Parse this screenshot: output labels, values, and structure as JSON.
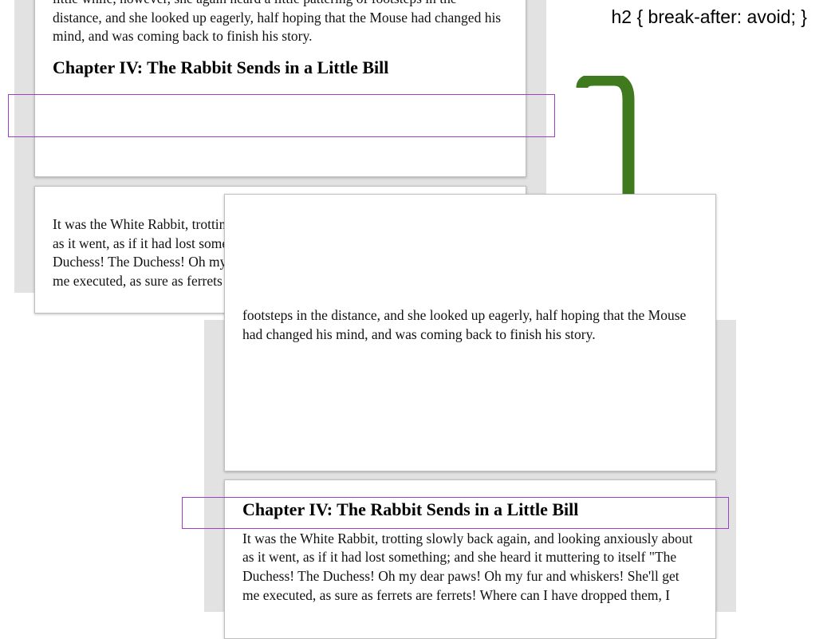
{
  "code_label": "h2 { break-after: avoid; }",
  "para_before_top": "little while, however, she again heard a little pattering of footsteps in the distance, and she looked up eagerly, half hoping that the Mouse had changed his mind, and was coming back to finish his story.",
  "heading": "Chapter IV: The Rabbit Sends in a Little Bill",
  "para_after": "It was the White Rabbit, trotting slowly back again, and looking anxiously about as it went, as if it had lost something; and she heard it muttering to itself \"The Duchess! The Duchess! Oh my dear paws! Oh my fur and whiskers! She'll get me executed, as sure as ferrets are ferrets! Where can I have dropped them, I",
  "para_before_bottom": "footsteps in the distance, and she looked up eagerly, half hoping that the Mouse had changed his mind, and was coming back to finish his story."
}
